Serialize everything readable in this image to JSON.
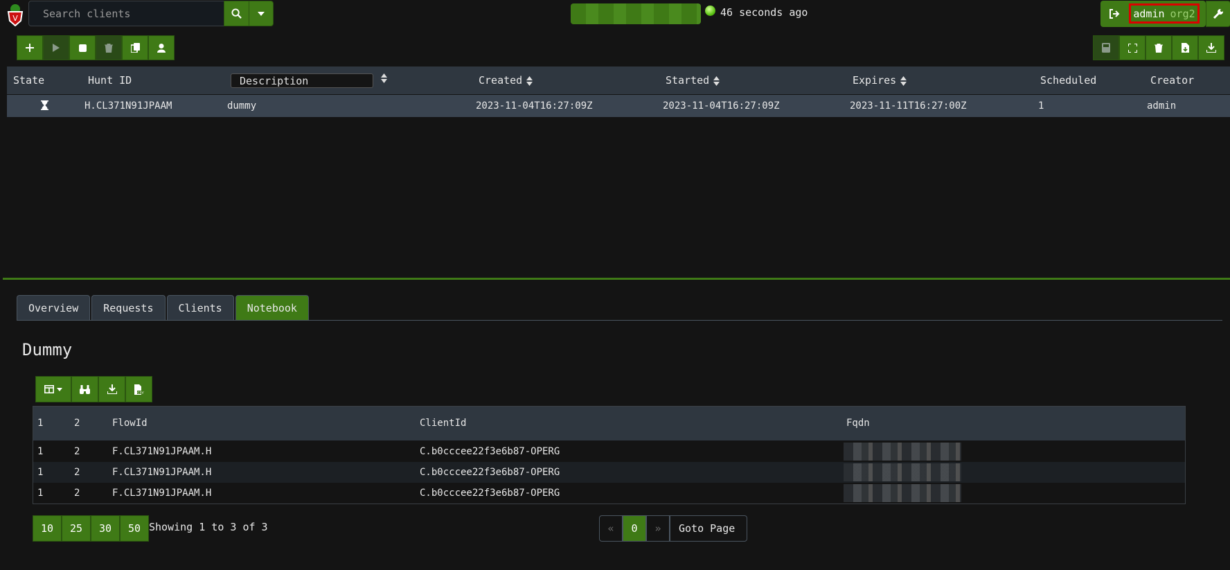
{
  "header": {
    "search_placeholder": "Search clients",
    "status_text": "46 seconds ago",
    "user": "admin",
    "org": "org2"
  },
  "hunt_table": {
    "columns": [
      "State",
      "Hunt ID",
      "Description",
      "Created",
      "Started",
      "Expires",
      "Scheduled",
      "Creator"
    ],
    "rows": [
      {
        "hunt_id": "H.CL371N91JPAAM",
        "description": "dummy",
        "created": "2023-11-04T16:27:09Z",
        "started": "2023-11-04T16:27:09Z",
        "expires": "2023-11-11T16:27:00Z",
        "scheduled": "1",
        "creator": "admin"
      }
    ]
  },
  "tabs": [
    "Overview",
    "Requests",
    "Clients",
    "Notebook"
  ],
  "notebook": {
    "title": "Dummy",
    "columns": [
      "1",
      "2",
      "FlowId",
      "ClientId",
      "Fqdn"
    ],
    "rows": [
      {
        "c1": "1",
        "c2": "2",
        "flow": "F.CL371N91JPAAM.H",
        "client": "C.b0cccee22f3e6b87-OPERG"
      },
      {
        "c1": "1",
        "c2": "2",
        "flow": "F.CL371N91JPAAM.H",
        "client": "C.b0cccee22f3e6b87-OPERG"
      },
      {
        "c1": "1",
        "c2": "2",
        "flow": "F.CL371N91JPAAM.H",
        "client": "C.b0cccee22f3e6b87-OPERG"
      }
    ]
  },
  "pagination": {
    "sizes": [
      "10",
      "25",
      "30",
      "50"
    ],
    "showing": "Showing 1 to 3 of 3",
    "prev": "«",
    "current": "0",
    "next": "»",
    "goto": "Goto Page"
  }
}
